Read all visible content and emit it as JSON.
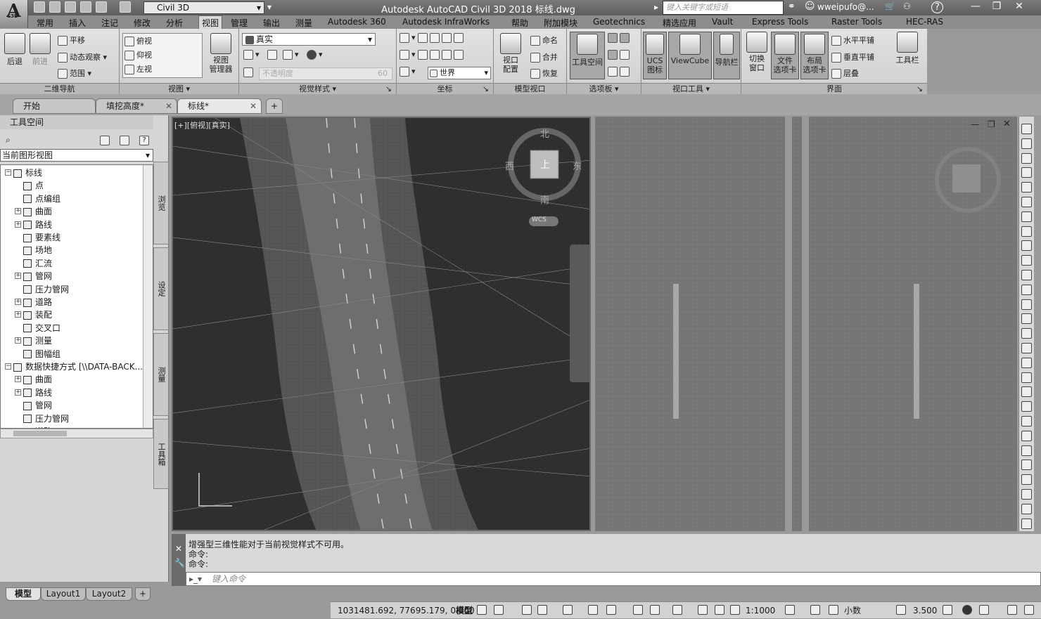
{
  "app": {
    "title": "Autodesk AutoCAD Civil 3D 2018   标线.dwg",
    "logo_text": "A",
    "logo_sub": "C3D",
    "workspace": "Civil 3D",
    "search_placeholder": "键入关键字或短语",
    "user": "wweipufo@...",
    "help": "?"
  },
  "menu": [
    "常用",
    "插入",
    "注记",
    "修改",
    "分析",
    "视图",
    "管理",
    "输出",
    "测量",
    "Autodesk 360",
    "Autodesk InfraWorks",
    "帮助",
    "附加模块",
    "Geotechnics",
    "精选应用",
    "Vault",
    "Express Tools",
    "Raster Tools",
    "HEC-RAS"
  ],
  "menu_active": "视图",
  "ribbon": {
    "nav": {
      "back": "后退",
      "forward": "前进",
      "pan": "平移",
      "orbit": "动态观察",
      "extents": "范围",
      "label": "二维导航"
    },
    "views": {
      "top": "俯视",
      "bottom": "仰视",
      "left": "左视",
      "manager": "视图\n管理器",
      "label": "视图"
    },
    "visualstyle": {
      "current": "真实",
      "opacity": "不透明度",
      "opacity_value": "60",
      "label": "视觉样式"
    },
    "coords": {
      "world": "世界",
      "label": "坐标"
    },
    "modelvp": {
      "config": "视口\n配置",
      "named": "命名",
      "join": "合并",
      "restore": "恢复",
      "label": "模型视口"
    },
    "palettes": {
      "toolspace": "工具空间",
      "label": "选项板"
    },
    "vptools": {
      "ucs": "UCS\n图标",
      "viewcube": "ViewCube",
      "navbar": "导航栏",
      "label": "视口工具"
    },
    "ui": {
      "switch": "切换\n窗口",
      "filetabs": "文件\n选项卡",
      "layouttabs": "布局\n选项卡",
      "tilehorz": "水平平铺",
      "tilevert": "垂直平铺",
      "cascade": "层叠",
      "toolbars": "工具栏",
      "label": "界面"
    }
  },
  "doctabs": [
    {
      "label": "开始",
      "close": ""
    },
    {
      "label": "填挖高度*",
      "close": "✕"
    },
    {
      "label": "标线*",
      "close": "✕"
    }
  ],
  "palette": {
    "title": "工具空间",
    "combo": "当前图形视图",
    "side_tabs": [
      "浏览",
      "设定",
      "测量",
      "工具箱"
    ],
    "tree": [
      {
        "label": "标线",
        "level": 0,
        "exp": "−"
      },
      {
        "label": "点",
        "level": 1,
        "exp": ""
      },
      {
        "label": "点编组",
        "level": 1,
        "exp": ""
      },
      {
        "label": "曲面",
        "level": 1,
        "exp": "+"
      },
      {
        "label": "路线",
        "level": 1,
        "exp": "+"
      },
      {
        "label": "要素线",
        "level": 1,
        "exp": ""
      },
      {
        "label": "场地",
        "level": 1,
        "exp": ""
      },
      {
        "label": "汇流",
        "level": 1,
        "exp": ""
      },
      {
        "label": "管网",
        "level": 1,
        "exp": "+"
      },
      {
        "label": "压力管网",
        "level": 1,
        "exp": ""
      },
      {
        "label": "道路",
        "level": 1,
        "exp": "+"
      },
      {
        "label": "装配",
        "level": 1,
        "exp": "+"
      },
      {
        "label": "交叉口",
        "level": 1,
        "exp": ""
      },
      {
        "label": "测量",
        "level": 1,
        "exp": "+"
      },
      {
        "label": "图幅组",
        "level": 1,
        "exp": ""
      },
      {
        "label": "数据快捷方式 [\\\\DATA-BACK...",
        "level": 0,
        "exp": "−"
      },
      {
        "label": "曲面",
        "level": 1,
        "exp": "+"
      },
      {
        "label": "路线",
        "level": 1,
        "exp": "+"
      },
      {
        "label": "管网",
        "level": 1,
        "exp": ""
      },
      {
        "label": "压力管网",
        "level": 1,
        "exp": ""
      },
      {
        "label": "道路",
        "level": 1,
        "exp": "+"
      }
    ]
  },
  "viewport": {
    "label": "[+][俯视][真实]",
    "compass": {
      "north": "北",
      "south": "南",
      "east": "东",
      "west": "西",
      "face": "上",
      "wcs": "WCS"
    }
  },
  "command": {
    "history": [
      "增强型三维性能对于当前视觉样式不可用。",
      "命令:",
      "命令:"
    ],
    "placeholder": "键入命令"
  },
  "layout_tabs": [
    "模型",
    "Layout1",
    "Layout2"
  ],
  "layout_add": "+",
  "status": {
    "coords": "1031481.692, 77695.179, 0.000",
    "space": "模型",
    "scale": "1:1000",
    "units": "小数",
    "elev": "3.500"
  }
}
